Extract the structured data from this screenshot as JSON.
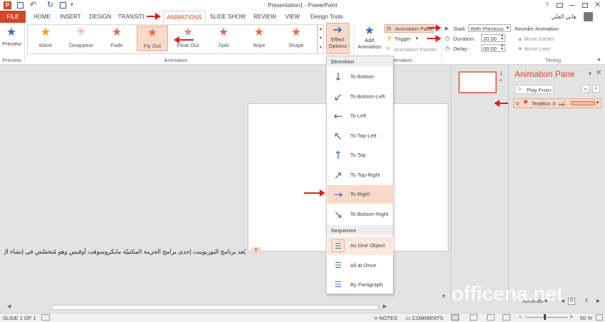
{
  "title": "Presentation1 - PowerPoint",
  "user": "هاني العلي",
  "tabs": {
    "file": "FILE",
    "home": "HOME",
    "insert": "INSERT",
    "design": "DESIGN",
    "transitions": "TRANSITI",
    "animations": "ANIMATIONS",
    "slideshow": "SLIDE SHOW",
    "review": "REVIEW",
    "view": "VIEW",
    "designtools": "Design Tools"
  },
  "ribbon": {
    "preview": "Preview",
    "preview_group": "Preview",
    "animation_group": "Animation",
    "effects": [
      "Wave",
      "Disappear",
      "Fade",
      "Fly Out",
      "Float Out",
      "Split",
      "Wipe",
      "Shape"
    ],
    "effect_options_1": "Effect",
    "effect_options_2": "Options",
    "add_anim_1": "Add",
    "add_anim_2": "Animation",
    "anim_pane": "Animation Pane",
    "trigger": "Trigger",
    "anim_painter": "Animation Painter",
    "adv_group": "d Animation",
    "start_label": "Start:",
    "start_value": "With Previous",
    "duration_label": "Duration:",
    "duration_value": "20.00",
    "delay_label": "Delay:",
    "delay_value": "00.00",
    "reorder": "Reorder Animation",
    "move_earlier": "Move Earlier",
    "move_later": "Move Later",
    "timing_group": "Timing"
  },
  "dropdown": {
    "direction_header": "Direction",
    "directions": [
      "To Bottom",
      "To Bottom-Left",
      "To Left",
      "To Top-Left",
      "To Top",
      "To Top-Right",
      "To Right",
      "To Bottom-Right"
    ],
    "sequence_header": "Sequence",
    "sequence": [
      "As One Object",
      "All at Once",
      "By Paragraph"
    ]
  },
  "slide": {
    "number": "1",
    "star": "*",
    "text": "يُعد برنامج البوربوينت إحدى برامج الحزمة المكتبيّة مايكروسوفت أوفيس وهو مُتخصّص في إنشاء ال",
    "tag": "0"
  },
  "pane": {
    "title": "Animation Pane",
    "play_from": "Play From",
    "item_num": "0",
    "item_label": "TextBox 3: يُعد..."
  },
  "status": {
    "slide": "SLIDE 1 OF 1",
    "notes": "NOTES",
    "comments": "COMMENTS",
    "zoom": "50 %",
    "seconds": "Seconds",
    "sec_0": "0",
    "sec_2": "2"
  },
  "watermark": "officena.net"
}
